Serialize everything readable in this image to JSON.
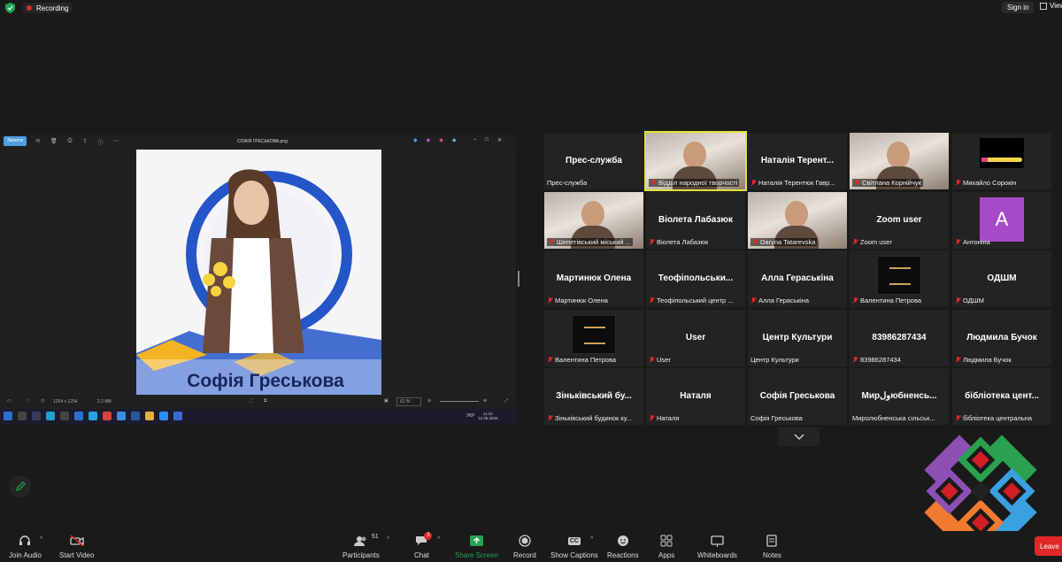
{
  "topbar": {
    "recording": "Recording",
    "sign_in": "Sign in",
    "view": "View"
  },
  "preview": {
    "button": "Змінити",
    "file_title": "СОФІЯ ГРЕСЬКОВА.png",
    "poster_name": "Софія Греськова",
    "status_dims": "1254 x 1254",
    "status_size": "2.2 MB",
    "zoom": "61 %",
    "clock_time": "11:32",
    "clock_date": "12.06.2025",
    "lang": "УКР"
  },
  "tiles": [
    {
      "name": "Прес-служба",
      "label": "Прес-служба",
      "muted": false,
      "video": false
    },
    {
      "name": "",
      "label": "Відділ народної творчості",
      "muted": true,
      "video": true,
      "active": true
    },
    {
      "name": "Наталія Терент...",
      "label": "Наталія Терентюк Гавр...",
      "muted": true,
      "video": false
    },
    {
      "name": "",
      "label": "Світлана Корнійчук",
      "muted": true,
      "video": true
    },
    {
      "name": "",
      "label": "Михайло Сорокін",
      "muted": true,
      "video": false,
      "avatar": "pencil"
    },
    {
      "name": "",
      "label": "Шепетівський міський ...",
      "muted": true,
      "video": true
    },
    {
      "name": "Віолета Лабазюк",
      "label": "Віолета Лабазюк",
      "muted": true,
      "video": false
    },
    {
      "name": "",
      "label": "Daryna Tatarevska",
      "muted": true,
      "video": true
    },
    {
      "name": "Zoom user",
      "label": "Zoom user",
      "muted": true,
      "video": false
    },
    {
      "name": "",
      "label": "Антоніна",
      "muted": true,
      "video": false,
      "avatar": "A"
    },
    {
      "name": "Мартинюк Олена",
      "label": "Мартинюк Олена",
      "muted": true,
      "video": false
    },
    {
      "name": "Теофіпольськи...",
      "label": "Теофіпольський центр ...",
      "muted": true,
      "video": false
    },
    {
      "name": "Алла Гераськіна",
      "label": "Алла Гераськіна",
      "muted": true,
      "video": false
    },
    {
      "name": "",
      "label": "Валентина Петрова",
      "muted": true,
      "video": false,
      "avatar": "centre"
    },
    {
      "name": "ОДШМ",
      "label": "ОДШМ",
      "muted": true,
      "video": false
    },
    {
      "name": "",
      "label": "Валентина Петрова",
      "muted": true,
      "video": false,
      "avatar": "centre"
    },
    {
      "name": "User",
      "label": "User",
      "muted": true,
      "video": false
    },
    {
      "name": "Центр Культури",
      "label": "Центр Культури",
      "muted": false,
      "video": false
    },
    {
      "name": "83986287434",
      "label": "83986287434",
      "muted": true,
      "video": false
    },
    {
      "name": "Людмила Бучок",
      "label": "Людмила Бучок",
      "muted": true,
      "video": false
    },
    {
      "name": "Зіньківський бу...",
      "label": "Зіньківський будинок ку...",
      "muted": true,
      "video": false
    },
    {
      "name": "Наталя",
      "label": "Наталя",
      "muted": true,
      "video": false
    },
    {
      "name": "Софія Греськова",
      "label": "Софія Греськова",
      "muted": false,
      "video": false
    },
    {
      "name": "Мирولюбненсь...",
      "label": "Миролюбненська сільськ...",
      "muted": false,
      "video": false
    },
    {
      "name": "бібліотека цент...",
      "label": "бібліотека центральна",
      "muted": true,
      "video": false
    }
  ],
  "toolbar": {
    "join_audio": "Join Audio",
    "start_video": "Start Video",
    "participants": "Participants",
    "participants_count": "51",
    "chat": "Chat",
    "chat_badge": "3",
    "share_screen": "Share Screen",
    "record": "Record",
    "show_captions": "Show Captions",
    "reactions": "Reactions",
    "apps": "Apps",
    "whiteboards": "Whiteboards",
    "notes": "Notes",
    "leave": "Leave"
  },
  "colors": {
    "accent_green": "#23a455",
    "leave_red": "#e02828",
    "active_border": "#e1e33a",
    "avatar_purple": "#a64ac9"
  }
}
